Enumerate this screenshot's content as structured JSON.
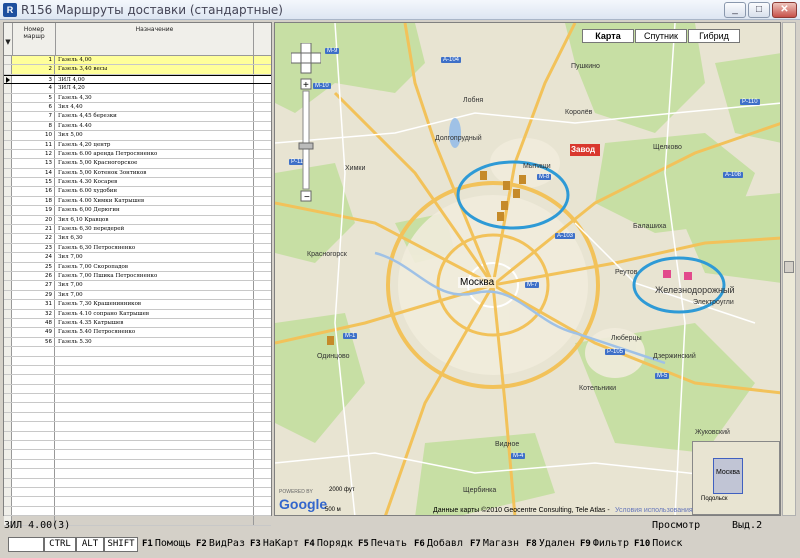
{
  "window": {
    "title": "R156 Маршруты доставки (стандартные)",
    "icon_text": "R",
    "minimize": "_",
    "maximize": "□",
    "close": "✕"
  },
  "grid": {
    "columns": [
      "Номер маршр",
      "Назначение"
    ],
    "filter_icon": "▼",
    "rows": [
      {
        "num": "1",
        "dest": "Газель 4,00"
      },
      {
        "num": "2",
        "dest": "Газель 3,40 весы"
      },
      {
        "num": "3",
        "dest": "ЗИЛ 4,00"
      },
      {
        "num": "4",
        "dest": "ЗИЛ 4,20"
      },
      {
        "num": "5",
        "dest": "Газель 4,30"
      },
      {
        "num": "6",
        "dest": "Зил 4,40"
      },
      {
        "num": "7",
        "dest": "Газель 4,45 березки"
      },
      {
        "num": "8",
        "dest": "Газель 4.40"
      },
      {
        "num": "10",
        "dest": "Зил 5,00"
      },
      {
        "num": "11",
        "dest": "Газель 4,20 центр"
      },
      {
        "num": "12",
        "dest": "Газель 6.00 аренда Петросяненко"
      },
      {
        "num": "13",
        "dest": "Газель 5,00 Красногорское"
      },
      {
        "num": "14",
        "dest": "Газель 5,00 Котенок Зонтиков"
      },
      {
        "num": "15",
        "dest": "Газель 4.30 Косарев"
      },
      {
        "num": "16",
        "dest": "Газель 6.00 худобин"
      },
      {
        "num": "18",
        "dest": "Газель 4.00 Химки Катрышев"
      },
      {
        "num": "19",
        "dest": "Газель 6,00 Дерюгин"
      },
      {
        "num": "20",
        "dest": "Зил 6,10 Кравцов"
      },
      {
        "num": "21",
        "dest": "Газель 6,30 передерей"
      },
      {
        "num": "22",
        "dest": "Зил 6,30"
      },
      {
        "num": "23",
        "dest": "Газель 6,30 Петросяненко"
      },
      {
        "num": "24",
        "dest": "Зил 7,00"
      },
      {
        "num": "25",
        "dest": "Газель 7,00 Скоропадов"
      },
      {
        "num": "26",
        "dest": "Газель 7,00 Пшика Петросяненко"
      },
      {
        "num": "27",
        "dest": "Зил 7,00"
      },
      {
        "num": "29",
        "dest": "Зил 7,00"
      },
      {
        "num": "31",
        "dest": "Газель 7,30 Крашенинников"
      },
      {
        "num": "32",
        "dest": "Газель 4.10 сопрано Катрышев"
      },
      {
        "num": "48",
        "dest": "Газель 4.35 Катрышев"
      },
      {
        "num": "49",
        "dest": "Газель 5.40 Петросяненко"
      },
      {
        "num": "56",
        "dest": "Газель 5.30"
      }
    ],
    "selected_rows": [
      0,
      1
    ],
    "current_row": 2
  },
  "map": {
    "type_buttons": [
      "Карта",
      "Спутник",
      "Гибрид"
    ],
    "active_type": "Карта",
    "center_label": "Москва",
    "cities": [
      "Химки",
      "Мытищи",
      "Долгопрудный",
      "Королёв",
      "Щелково",
      "Балашиха",
      "Реутов",
      "Люберцы",
      "Красногорск",
      "Одинцово",
      "Видное",
      "Дзержинский",
      "Котельники",
      "Пушкино",
      "Лобня",
      "Железнодорожный",
      "Электроугли",
      "Жуковский",
      "Подольск",
      "Щербинка"
    ],
    "roads": [
      "А-104",
      "М-10",
      "М-8",
      "М-7",
      "М-4",
      "М-5",
      "М-1",
      "М-9",
      "Р-111",
      "А-103",
      "Р-110",
      "А-108",
      "Р-105"
    ],
    "marker_label": "Завод",
    "attribution": "Данные карты ©2010 Geocentre Consulting, Tele Atlas -",
    "terms": "Условия использования",
    "powered_by": "POWERED BY",
    "google": "Google",
    "scale": [
      "2000 фут",
      "500 м"
    ],
    "overview_label": "Москва",
    "overview_sub": "Подольск"
  },
  "status": {
    "left": "ЗИЛ 4.00(3)",
    "mode": "Просмотр",
    "selected": "Выд.2"
  },
  "keys": {
    "boxes": [
      "",
      "CTRL",
      "ALT",
      "SHIFT"
    ],
    "fkeys": [
      {
        "k": "F1",
        "label": "Помощь"
      },
      {
        "k": "F2",
        "label": "ВидРаз"
      },
      {
        "k": "F3",
        "label": "НаКарт"
      },
      {
        "k": "F4",
        "label": "Порядк"
      },
      {
        "k": "F5",
        "label": "Печать"
      },
      {
        "k": "F6",
        "label": "Добавл"
      },
      {
        "k": "F7",
        "label": "Магазн"
      },
      {
        "k": "F8",
        "label": "Удален"
      },
      {
        "k": "F9",
        "label": "Фильтр"
      },
      {
        "k": "F10",
        "label": "Поиск"
      }
    ]
  },
  "colors": {
    "selected_row": "#ffff9a",
    "circle": "#2e9ad6",
    "highway": "#f2c25a",
    "road": "#ffffff",
    "green": "#c7dfa4",
    "urban": "#ede7d4"
  }
}
